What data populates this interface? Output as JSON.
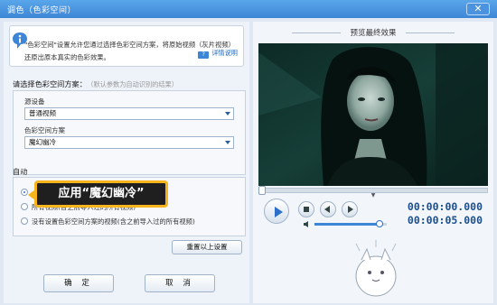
{
  "window": {
    "title": "调色（色彩空间）",
    "close_label": "✕"
  },
  "info": {
    "text": "\"色彩空间\"设置允许您通过选择色彩空间方案，将原始视频（灰片视频）还原出原本真实的色彩效果。",
    "link": "详情说明"
  },
  "color_space": {
    "title": "请选择色彩空间方案：",
    "hint": "（默认参数为自动识别的结果）",
    "source_device_label": "源设备",
    "source_device_value": "普通视频",
    "scheme_label": "色彩空间方案",
    "scheme_value": "魔幻幽冷"
  },
  "auto": {
    "title": "自动",
    "options": [
      "所有视频(含之前导入过的所有视频)",
      "没有设置色彩空间方案的视频(含之前导入过的所有视频)"
    ]
  },
  "buttons": {
    "reset": "重置以上设置",
    "ok": "确 定",
    "cancel": "取 消"
  },
  "tooltip": {
    "text": "应用“魔幻幽冷”"
  },
  "preview": {
    "title": "预览最终效果",
    "time_current": "00:00:00.000",
    "time_total": "00:00:05.000",
    "seek_progress": 0.0,
    "volume_level": 0.9
  },
  "colors": {
    "accent": "#3d86d6",
    "tooltip_border": "#f6b51c",
    "video_tint": "#0f3a33"
  }
}
